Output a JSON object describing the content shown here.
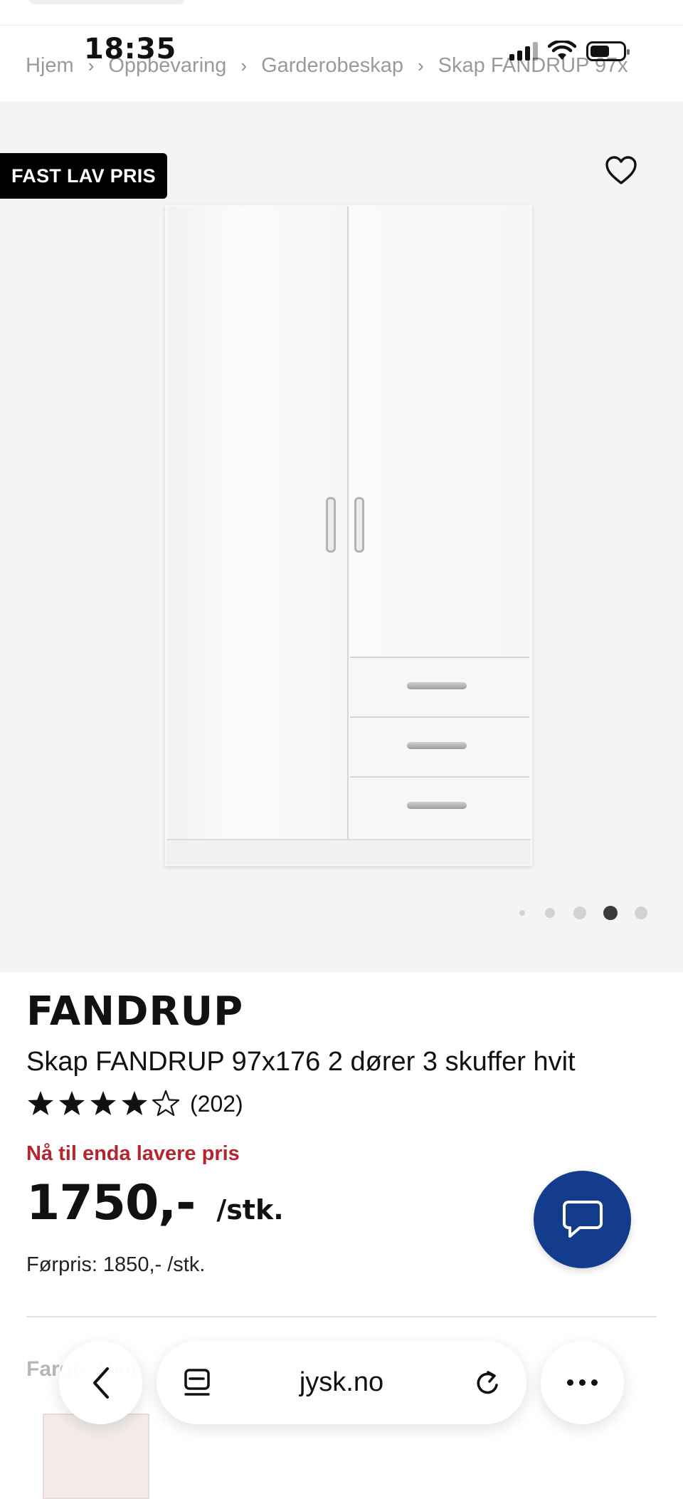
{
  "status_bar": {
    "time": "18:35",
    "signal_icon": "cellular-signal-icon",
    "wifi_icon": "wifi-icon",
    "battery_icon": "battery-icon"
  },
  "breadcrumb": [
    {
      "label": "Hjem"
    },
    {
      "label": "Oppbevaring"
    },
    {
      "label": "Garderobeskap"
    },
    {
      "label": "Skap FANDRUP 97x"
    }
  ],
  "gallery": {
    "badge": "FAST LAV PRIS",
    "favorite_icon": "heart-outline-icon",
    "image_count": 5,
    "active_image_index": 3
  },
  "product": {
    "brand": "FANDRUP",
    "title": "Skap FANDRUP 97x176 2 dører 3 skuffer hvit",
    "rating": 4,
    "rating_max": 5,
    "rating_count": "(202)",
    "promo": "Nå til enda lavere pris",
    "price": "1750,-",
    "unit": "/stk.",
    "previous_price": "Førpris: 1850,- /stk."
  },
  "colors": {
    "accent_red": "#b3262f",
    "chat_blue": "#143c8c",
    "badge_black": "#000000"
  },
  "color_section": {
    "label": "Farge: Hvit"
  },
  "browser": {
    "url": "jysk.no",
    "back_icon": "chevron-left-icon",
    "tabs_icon": "tabs-icon",
    "reload_icon": "reload-icon",
    "more_icon": "more-dots-icon"
  },
  "chat": {
    "icon": "chat-bubble-icon"
  }
}
